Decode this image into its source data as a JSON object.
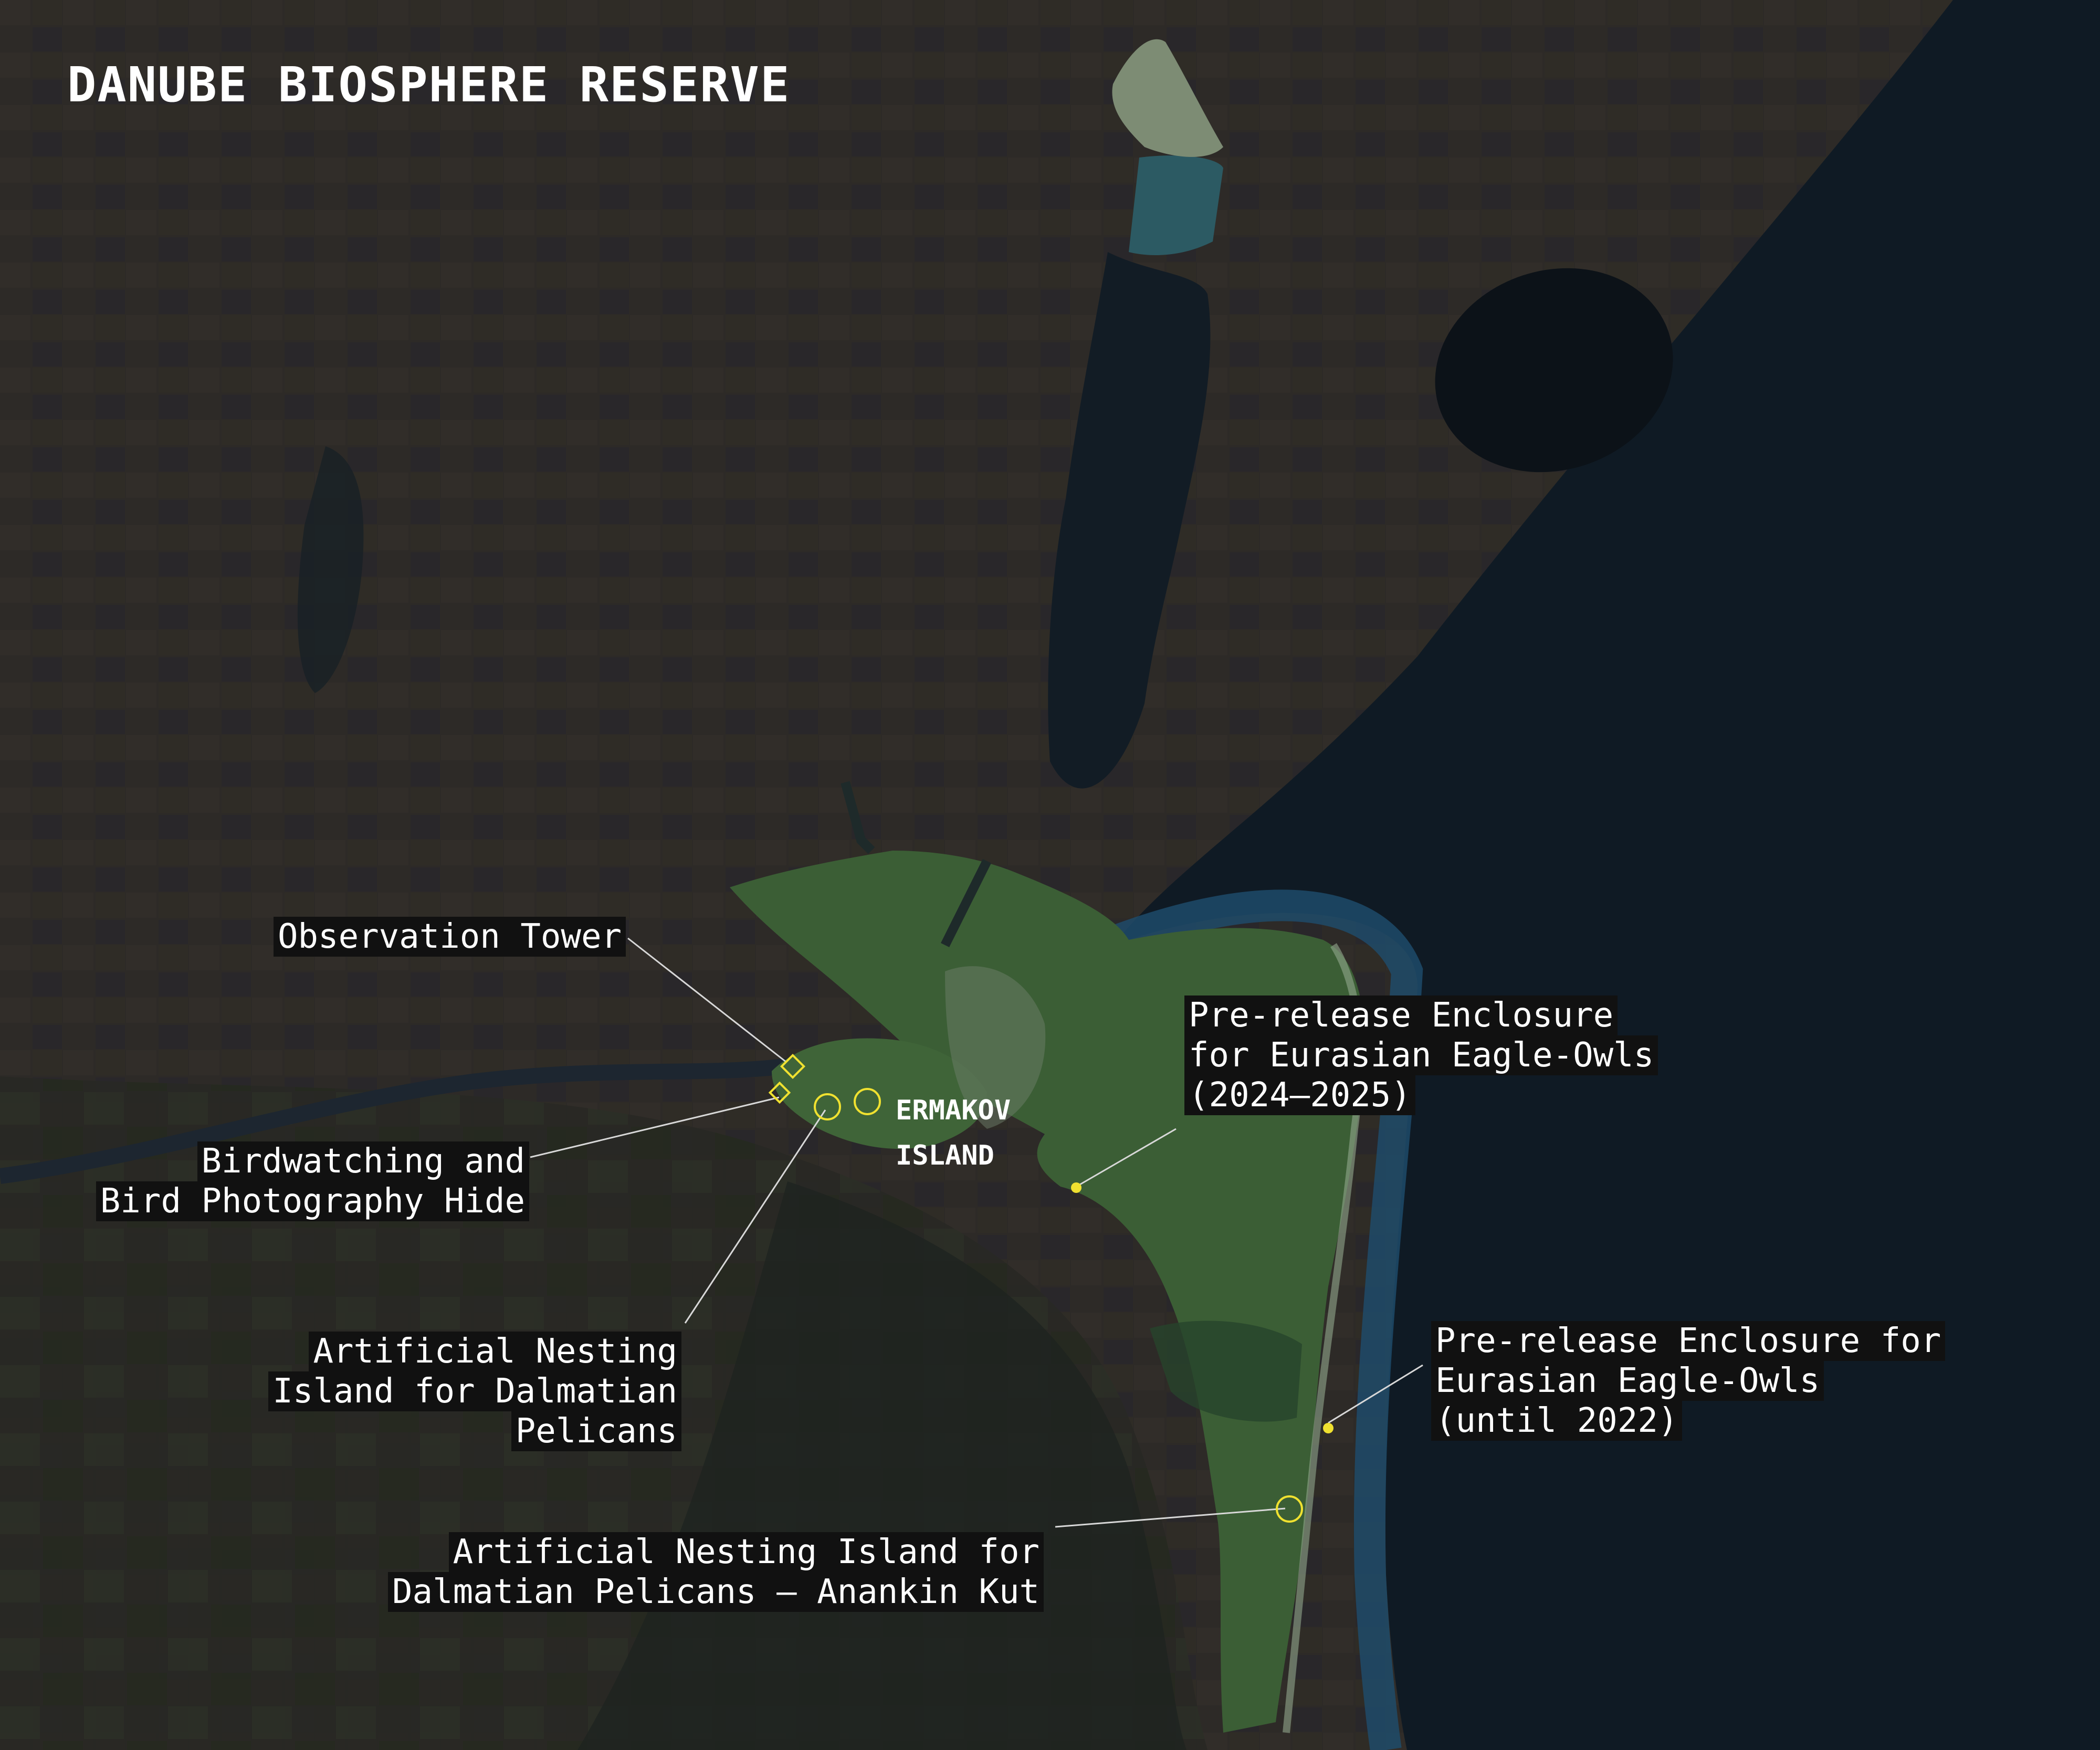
{
  "title": "DANUBE BIOSPHERE RESERVE",
  "island_label": {
    "line1": "ERMAKOV",
    "line2": "ISLAND"
  },
  "labels": {
    "observation_tower": {
      "line1": "Observation Tower"
    },
    "birdwatching_hide": {
      "line1": "Birdwatching and",
      "line2": "Bird Photography Hide"
    },
    "nesting_island": {
      "line1": "Artificial Nesting",
      "line2": "Island for Dalmatian",
      "line3": "Pelicans"
    },
    "nesting_island_anankin": {
      "line1": "Artificial Nesting Island for",
      "line2": "Dalmatian Pelicans – Anankin Kut"
    },
    "enclosure_2024": {
      "line1": "Pre-release Enclosure",
      "line2": "for Eurasian Eagle-Owls",
      "line3": "(2024–2025)"
    },
    "enclosure_2022": {
      "line1": "Pre-release Enclosure for",
      "line2": "Eurasian Eagle-Owls",
      "line3": "(until 2022)"
    }
  },
  "colors": {
    "land": "#2d2a27",
    "sea": "#0f1a24",
    "lagoon": "#121c25",
    "reserve": "#3b5e35",
    "marker": "#f0e130",
    "leader": "#d8d8d8"
  },
  "icons": {
    "tower": "diamond-marker-icon",
    "hide": "diamond-marker-icon",
    "nest": "circle-marker-icon",
    "enclosure": "dot-marker-icon"
  }
}
